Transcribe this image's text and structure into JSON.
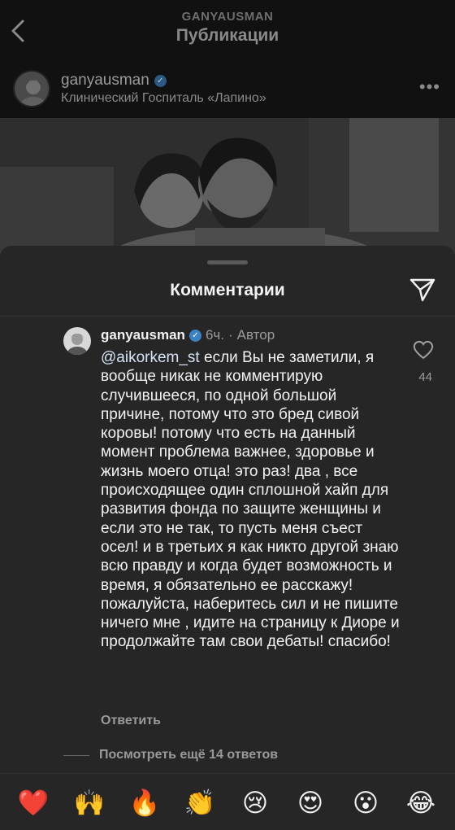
{
  "header": {
    "subtitle": "GANYAUSMAN",
    "title": "Публикации"
  },
  "post": {
    "username": "ganyausman",
    "location": "Клинический Госпиталь «Лапино»",
    "more": "•••"
  },
  "sheet": {
    "title": "Комментарии"
  },
  "comment": {
    "username": "ganyausman",
    "time": "6ч.",
    "separator": "·",
    "author_badge": "Автор",
    "mention": "@aikorkem_st",
    "text": " если Вы не заметили, я вообще никак не комментирую случившееся, по одной большой причине, потому что это бред сивой коровы! потому что есть на данный момент проблема важнее, здоровье и жизнь моего отца! это раз! два , все происходящее один сплошной хайп для развития фонда по защите женщины и если это не так, то пусть меня съест осел! и в третьих я как никто другой знаю всю правду и когда будет возможность и время, я обязательно ее расскажу! пожалуйста, наберитесь сил и не пишите ничего мне , идите на страницу к Диоре и продолжайте там свои дебаты! спасибо!",
    "likes": "44",
    "reply_label": "Ответить",
    "view_replies": "Посмотреть ещё 14 ответов"
  },
  "emoji_bar": [
    "❤️",
    "🙌",
    "🔥",
    "👏",
    "😢",
    "😍",
    "😮",
    "😂"
  ],
  "colors": {
    "sheet_bg": "#262626",
    "verified": "#3b82c4",
    "secondary_text": "#9a9a9a"
  }
}
